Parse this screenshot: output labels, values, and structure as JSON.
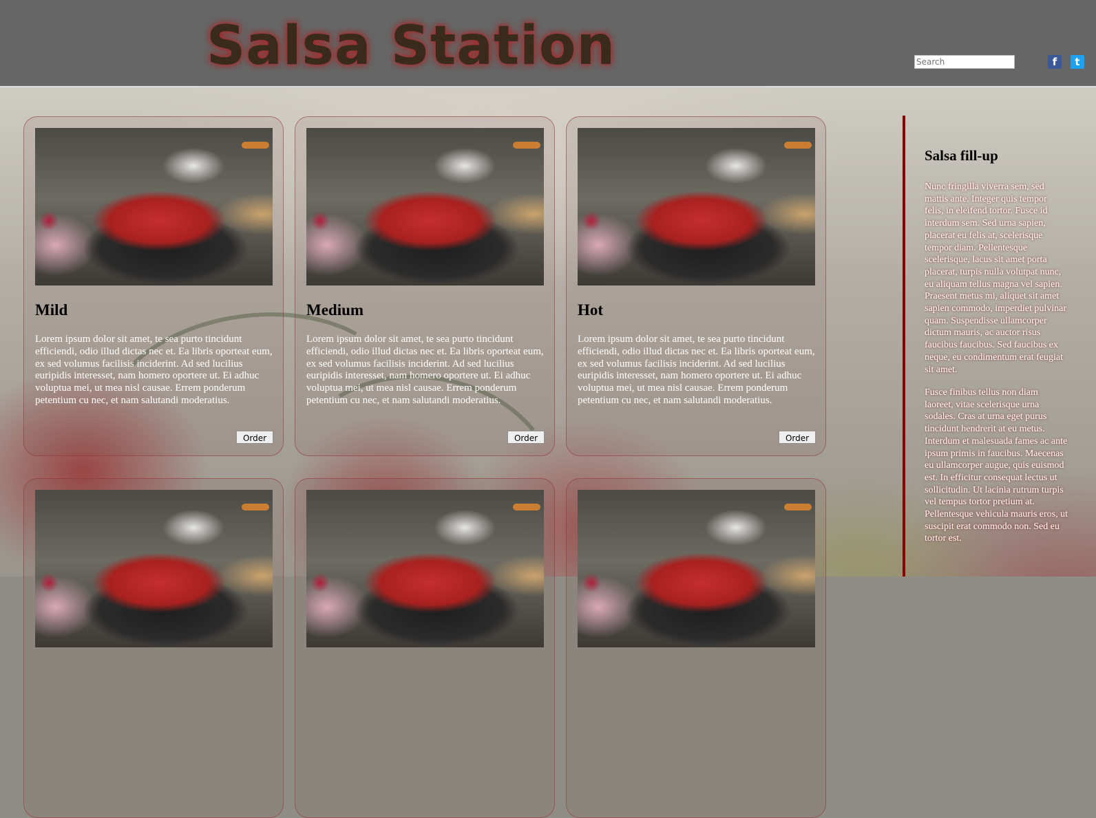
{
  "header": {
    "logo_text": "Salsa Station",
    "search_placeholder": "Search",
    "social": {
      "facebook_glyph": "f",
      "twitter_glyph": "t"
    }
  },
  "cards": [
    {
      "title": "Mild",
      "body": "Lorem ipsum dolor sit amet, te sea purto tincidunt efficiendi, odio illud dictas nec et. Ea libris oporteat eum, ex sed volumus facilisis inciderint. Ad sed lucilius euripidis interesset, nam homero oportere ut. Ei adhuc voluptua mei, ut mea nisl causae. Errem ponderum petentium cu nec, et nam salutandi moderatius.",
      "order_label": "Order"
    },
    {
      "title": "Medium",
      "body": "Lorem ipsum dolor sit amet, te sea purto tincidunt efficiendi, odio illud dictas nec et. Ea libris oporteat eum, ex sed volumus facilisis inciderint. Ad sed lucilius euripidis interesset, nam homero oportere ut. Ei adhuc voluptua mei, ut mea nisl causae. Errem ponderum petentium cu nec, et nam salutandi moderatius.",
      "order_label": "Order"
    },
    {
      "title": "Hot",
      "body": "Lorem ipsum dolor sit amet, te sea purto tincidunt efficiendi, odio illud dictas nec et. Ea libris oporteat eum, ex sed volumus facilisis inciderint. Ad sed lucilius euripidis interesset, nam homero oportere ut. Ei adhuc voluptua mei, ut mea nisl causae. Errem ponderum petentium cu nec, et nam salutandi moderatius.",
      "order_label": "Order"
    }
  ],
  "sidebar": {
    "title": "Salsa fill-up",
    "paragraph1_lines": [
      "Nunc fringilla viverra sem, sed",
      "mattis ante. Integer quis tempor",
      "felis, in eleifend tortor. Fusce id",
      "interdum sem. Sed urna sapien,",
      "placerat eu felis at, scelerisque",
      "tempor diam. Pellentesque",
      "scelerisque, lacus sit amet porta",
      "placerat, turpis nulla volutpat nunc,",
      "eu aliquam tellus magna vel sapien.",
      "Praesent metus mi, aliquet sit amet",
      "sapien commodo, imperdiet pulvinar",
      "quam. Suspendisse ullamcorper",
      "dictum mauris, ac auctor risus",
      "faucibus faucibus. Sed faucibus ex",
      "neque, eu condimentum erat feugiat",
      "sit amet."
    ],
    "paragraph2_lines": [
      "Fusce finibus tellus non diam",
      "laoreet, vitae scelerisque urna",
      "sodales. Cras at urna eget purus",
      "tincidunt hendrerit at eu metus.",
      "Interdum et malesuada fames ac ante",
      "ipsum primis in faucibus. Maecenas",
      "eu ullamcorper augue, quis euismod",
      "est. In efficitur consequat lectus ut",
      "sollicitudin. Ut lacinia rutrum turpis",
      "vel tempus tortor pretium at.",
      "Pellentesque vehicula mauris eros, ut",
      "suscipit erat commodo non. Sed eu",
      "tortor est."
    ]
  },
  "colors": {
    "header_bg": "#666666",
    "logo_text": "#3a2a1c",
    "logo_glow": "#b03030",
    "sidebar_rule": "#8b0000",
    "facebook": "#3b5998",
    "twitter": "#1da1f2"
  }
}
